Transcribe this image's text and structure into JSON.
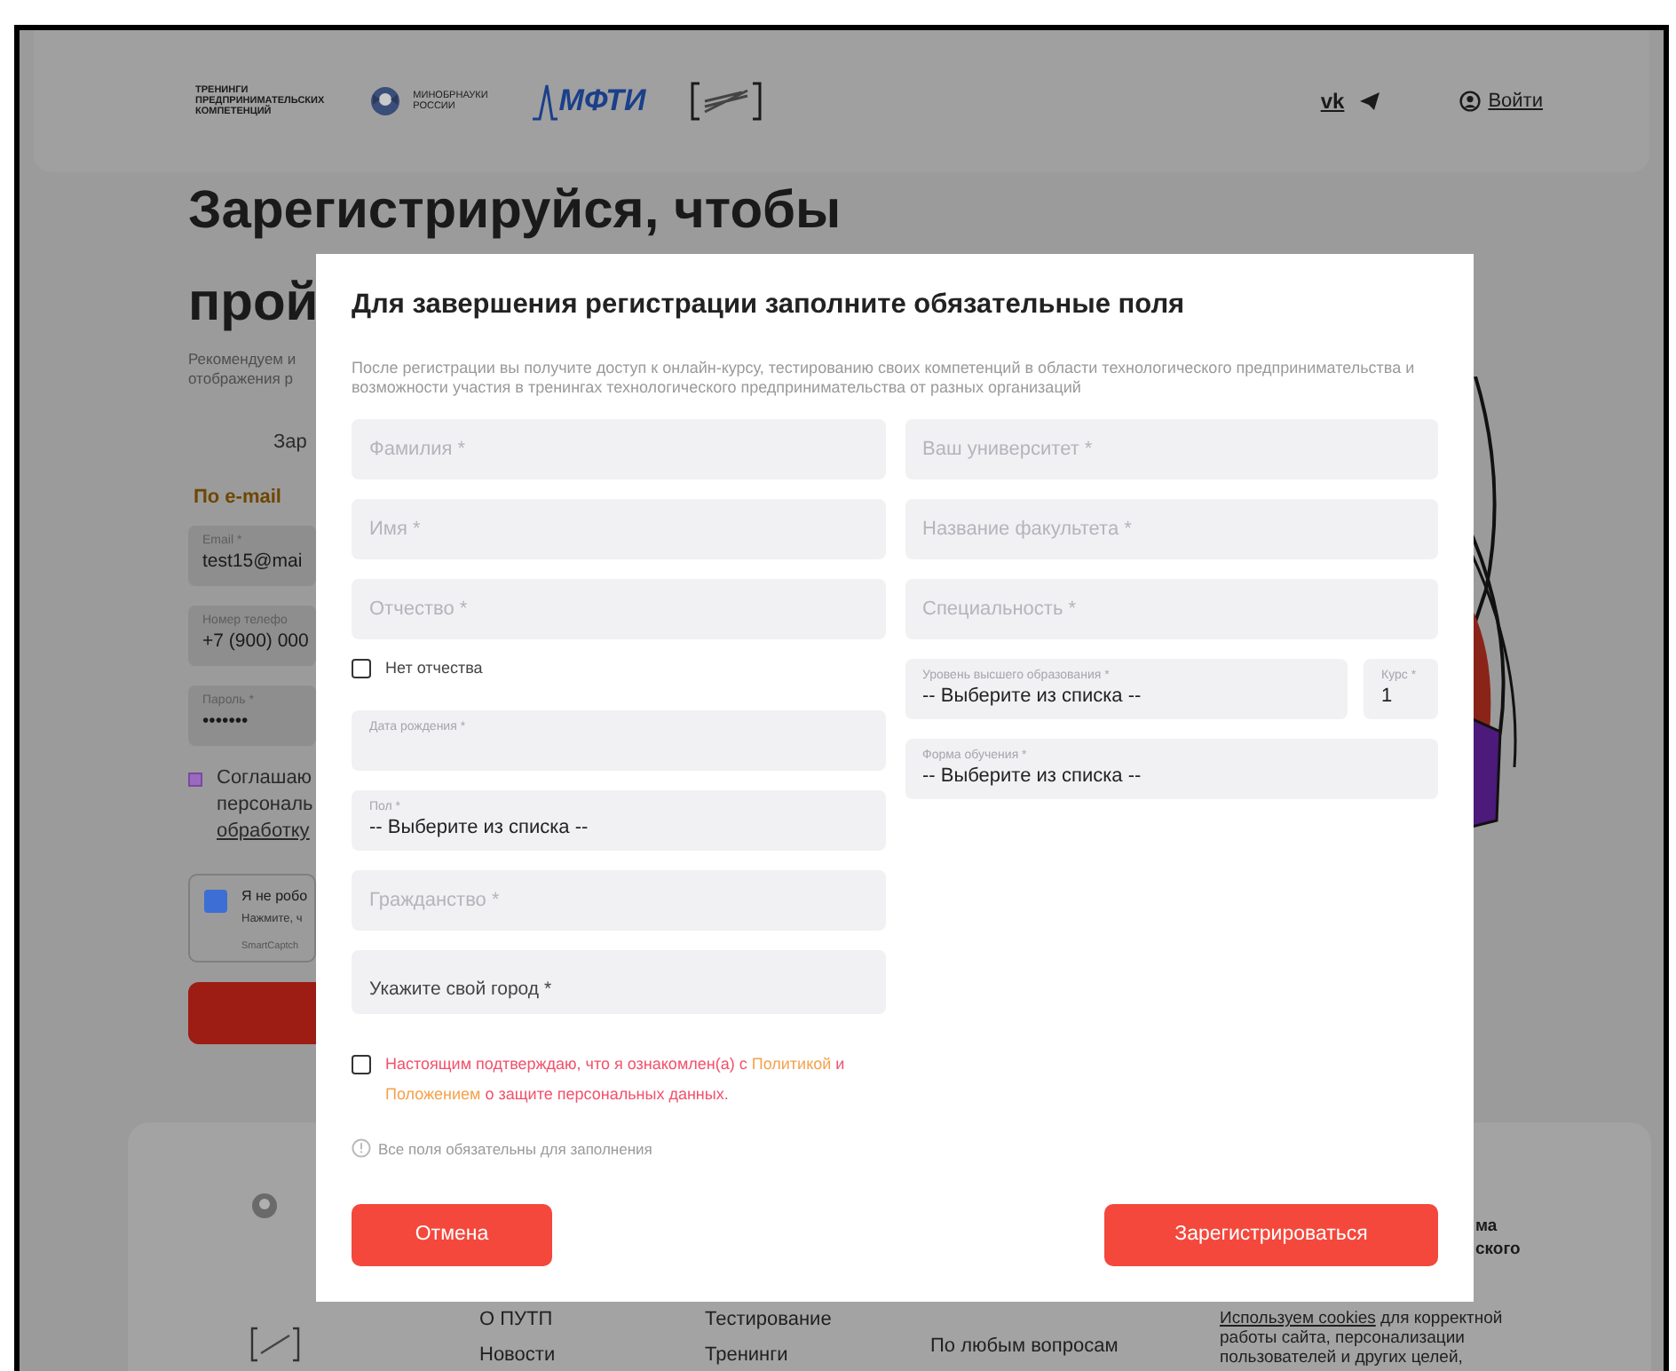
{
  "page": {
    "header": {
      "logo_lines": [
        "ТРЕНИНГИ",
        "ПРЕДПРИНИМАТЕЛЬСКИХ",
        "КОМПЕТЕНЦИЙ"
      ],
      "ministry_lines": [
        "МИНОБРНАУКИ",
        "РОССИИ"
      ],
      "mipt": "МФТИ",
      "social": "vk",
      "login": "Войти"
    },
    "heading": [
      "Зарегистрируйся, чтобы",
      "прой"
    ],
    "intro": [
      "Рекомендуем и",
      "отображения р"
    ],
    "tab": "Зар",
    "method": "По e-mail",
    "fields": [
      {
        "label": "Email *",
        "value": "test15@mai"
      },
      {
        "label": "Номер телефо",
        "value": "+7 (900) 000"
      },
      {
        "label": "Пароль *",
        "value": "•••••••"
      }
    ],
    "agree": {
      "checked": true,
      "lines": [
        "Соглашаю",
        "персональ",
        "обработку"
      ]
    },
    "captcha": {
      "checked": true,
      "title": "Я не робо",
      "hint": "Нажмите, ч",
      "brand": "SmartCaptch"
    },
    "footer": {
      "aside": [
        "ма",
        "ского"
      ],
      "columns": [
        [
          "О ПУТП",
          "Новости"
        ],
        [
          "Тестирование",
          "Тренинги"
        ]
      ],
      "contact": "По любым вопросам",
      "cookies": {
        "link": "Используем cookies",
        "text": "для корректной работы сайта, персонализации пользователей и других целей,"
      }
    }
  },
  "modal": {
    "title": "Для завершения регистрации заполните обязательные поля",
    "description": "После регистрации вы получите доступ к онлайн-курсу, тестированию своих компетенций в области технологического предпринимательства и возможности участия в тренингах технологического предпринимательства от разных организаций",
    "left_fields": [
      {
        "kind": "input",
        "placeholder": "Фамилия *"
      },
      {
        "kind": "input",
        "placeholder": "Имя *"
      },
      {
        "kind": "input",
        "placeholder": "Отчество *"
      },
      {
        "kind": "checkbox",
        "label": "Нет отчества",
        "checked": false
      },
      {
        "kind": "date",
        "label": "Дата рождения *"
      },
      {
        "kind": "select",
        "label": "Пол *",
        "value": "-- Выберите из списка --"
      },
      {
        "kind": "input",
        "placeholder": "Гражданство *"
      },
      {
        "kind": "lookup",
        "label": "Укажите свой город *"
      }
    ],
    "right_fields": [
      {
        "kind": "input",
        "placeholder": "Ваш университет *"
      },
      {
        "kind": "input",
        "placeholder": "Название факультета *"
      },
      {
        "kind": "input",
        "placeholder": "Специальность *"
      },
      {
        "kind": "pair",
        "fields": [
          {
            "kind": "select",
            "label": "Уровень высшего образования *",
            "value": "-- Выберите из списка --"
          },
          {
            "kind": "select",
            "label": "Курс *",
            "value": "1"
          }
        ]
      },
      {
        "kind": "select",
        "label": "Форма обучения *",
        "value": "-- Выберите из списка --"
      }
    ],
    "consent": {
      "checked": false,
      "parts": [
        {
          "kind": "text",
          "text": "Настоящим подтверждаю, что я ознакомлен(а) с"
        },
        {
          "kind": "link",
          "text": "Политикой"
        },
        {
          "kind": "text",
          "text": "и"
        },
        {
          "kind": "link",
          "text": "Положением"
        },
        {
          "kind": "text",
          "text": "о защите персональных данных."
        }
      ]
    },
    "note": "Все поля обязательны для заполнения",
    "buttons": [
      {
        "kind": "cancel",
        "label": "Отмена"
      },
      {
        "kind": "submit",
        "label": "Зарегистрироваться"
      }
    ]
  }
}
